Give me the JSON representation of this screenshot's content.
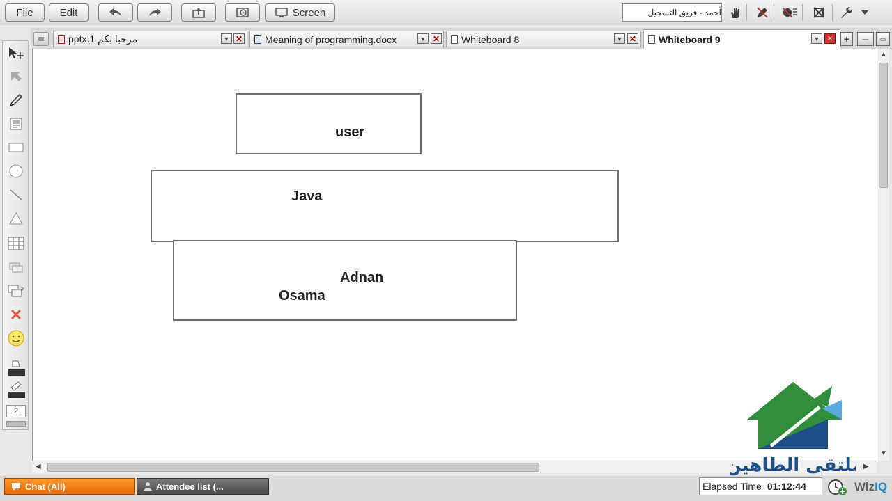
{
  "toolbar": {
    "file_label": "File",
    "edit_label": "Edit",
    "screen_label": "Screen",
    "user_name": "أحمد - فريق التسجيل",
    "icons": [
      "undo-icon",
      "redo-icon",
      "upload-icon",
      "record-icon",
      "screen-share-icon",
      "raise-hand-icon",
      "pen-permission-icon",
      "audio-icon",
      "clear-icon",
      "settings-icon",
      "dropdown-icon"
    ]
  },
  "tabs": [
    {
      "label": "مرحبا بكم 1.pptx"
    },
    {
      "label": "Meaning of programming.docx"
    },
    {
      "label": "Whiteboard 8"
    },
    {
      "label": "Whiteboard 9"
    }
  ],
  "tools": {
    "page_number": "2",
    "items": [
      "select-move-icon",
      "pointer-icon",
      "pen-icon",
      "text-icon",
      "rectangle-icon",
      "ellipse-icon",
      "line-icon",
      "triangle-icon",
      "table-icon",
      "eraser-icon",
      "layers-icon",
      "delete-icon",
      "emoticon-icon",
      "fill-color-icon",
      "line-color-icon"
    ]
  },
  "whiteboard": {
    "text_user": "user",
    "text_java": "Java",
    "text_adnan": "Adnan",
    "text_osama": "Osama"
  },
  "bottom": {
    "chat_label": "Chat (All)",
    "attendee_label": "Attendee list (...",
    "elapsed_label": "Elapsed Time",
    "elapsed_value": "01:12:44",
    "brand_prefix": "Wiz",
    "brand_suffix": "IQ"
  },
  "watermark": {
    "text": "ملتقى الطاهين"
  },
  "colors": {
    "accent_orange": "#f07d10",
    "brand_blue": "#1e88c8",
    "logo_green": "#2e8b3a"
  }
}
